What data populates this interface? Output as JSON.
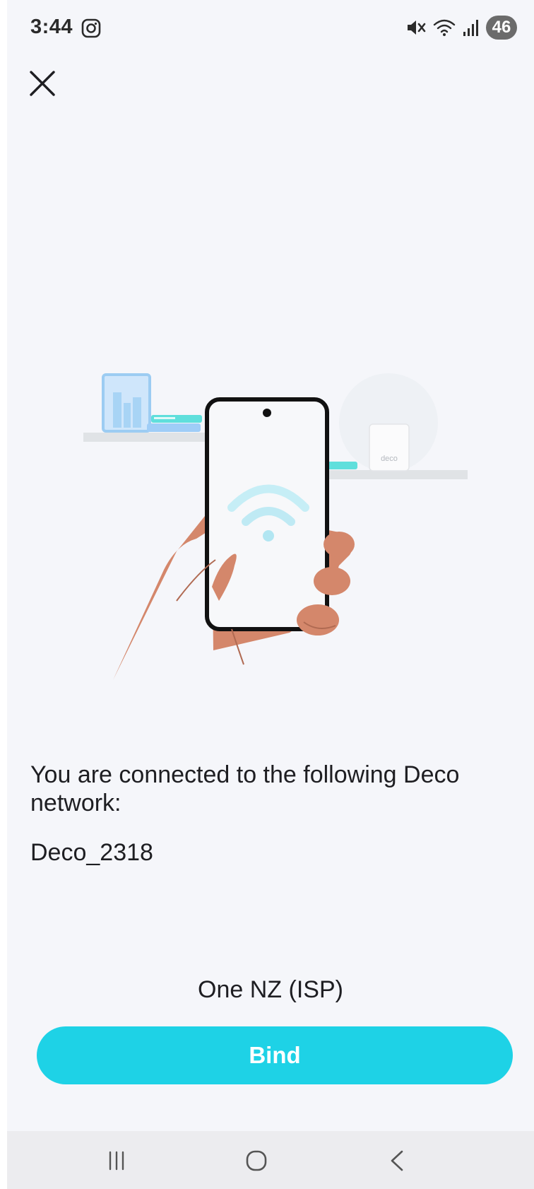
{
  "status_bar": {
    "time": "3:44",
    "battery_level": "46",
    "icons": [
      "instagram-icon",
      "mute-icon",
      "wifi-icon",
      "signal-icon"
    ]
  },
  "header": {
    "close_icon": "close-icon"
  },
  "illustration": {
    "router_label": "deco"
  },
  "main": {
    "connected_text": "You are connected to the following Deco network:",
    "network_name": "Deco_2318",
    "isp_label": "One NZ (ISP)",
    "bind_label": "Bind"
  },
  "colors": {
    "accent": "#1ed2e6",
    "background": "#f5f6fa",
    "skin": "#d4876b"
  },
  "nav_bar": {
    "icons": [
      "recent-apps-icon",
      "home-icon",
      "back-icon"
    ]
  }
}
